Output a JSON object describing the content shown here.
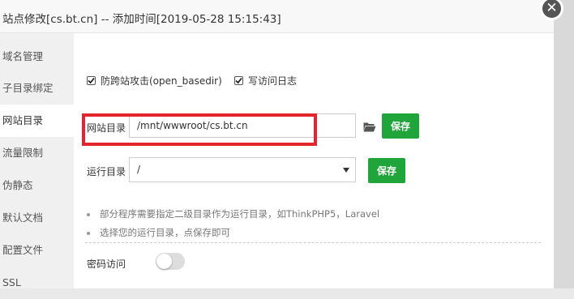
{
  "dialog": {
    "title": "站点修改[cs.bt.cn] -- 添加时间[2019-05-28 15:15:43]",
    "close_icon": "close-icon"
  },
  "sidebar": {
    "items": [
      {
        "label": "域名管理",
        "active": false
      },
      {
        "label": "子目录绑定",
        "active": false
      },
      {
        "label": "网站目录",
        "active": true
      },
      {
        "label": "流量限制",
        "active": false
      },
      {
        "label": "伪静态",
        "active": false
      },
      {
        "label": "默认文档",
        "active": false
      },
      {
        "label": "配置文件",
        "active": false
      },
      {
        "label": "SSL",
        "active": false
      }
    ]
  },
  "options": {
    "anti_xss_label": "防跨站攻击(open_basedir)",
    "anti_xss_checked": true,
    "access_log_label": "写访问日志",
    "access_log_checked": true
  },
  "site_dir": {
    "label": "网站目录",
    "value": "/mnt/wwwroot/cs.bt.cn",
    "save_label": "保存"
  },
  "run_dir": {
    "label": "运行目录",
    "value": "/",
    "save_label": "保存"
  },
  "hints": [
    "部分程序需要指定二级目录作为运行目录，如ThinkPHP5，Laravel",
    "选择您的运行目录，点保存即可"
  ],
  "password_access": {
    "label": "密码访问",
    "enabled": false
  },
  "colors": {
    "accent_green": "#20a53a",
    "highlight_red": "#e3252d"
  }
}
